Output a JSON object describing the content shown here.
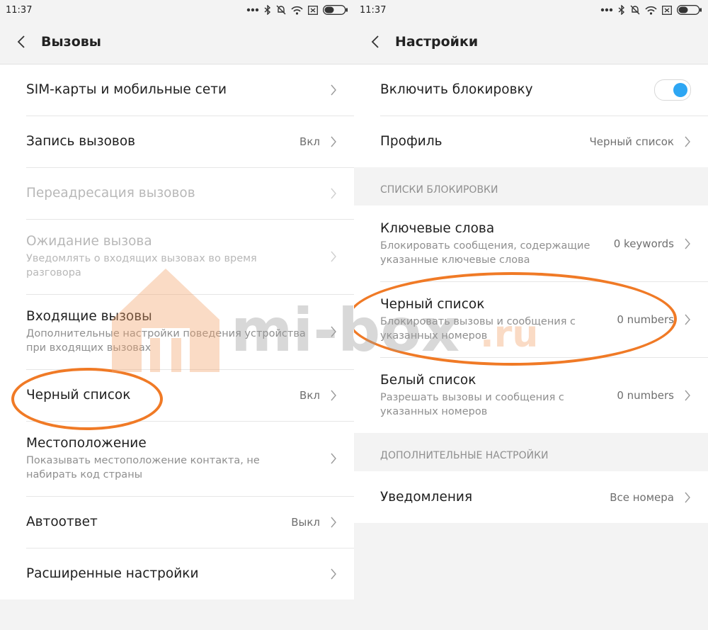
{
  "left": {
    "status": {
      "time": "11:37"
    },
    "header": {
      "title": "Вызовы"
    },
    "items": [
      {
        "title": "SIM-карты и мобильные сети",
        "value": "",
        "subtitle": ""
      },
      {
        "title": "Запись вызовов",
        "value": "Вкл",
        "subtitle": ""
      },
      {
        "title": "Переадресация вызовов",
        "value": "",
        "subtitle": ""
      },
      {
        "title": "Ожидание вызова",
        "value": "",
        "subtitle": "Уведомлять о входящих вызовах во время разговора"
      },
      {
        "title": "Входящие вызовы",
        "value": "",
        "subtitle": "Дополнительные настройки поведения устройства при входящих вызовах"
      },
      {
        "title": "Черный список",
        "value": "Вкл",
        "subtitle": ""
      },
      {
        "title": "Местоположение",
        "value": "",
        "subtitle": "Показывать местоположение контакта, не набирать код страны"
      },
      {
        "title": "Автоответ",
        "value": "Выкл",
        "subtitle": ""
      },
      {
        "title": "Расширенные настройки",
        "value": "",
        "subtitle": ""
      }
    ]
  },
  "right": {
    "status": {
      "time": "11:37"
    },
    "header": {
      "title": "Настройки"
    },
    "top_items": [
      {
        "title": "Включить блокировку",
        "toggle_on": true
      },
      {
        "title": "Профиль",
        "value": "Черный список"
      }
    ],
    "section1": {
      "header": "СПИСКИ БЛОКИРОВКИ",
      "items": [
        {
          "title": "Ключевые слова",
          "subtitle": "Блокировать сообщения, содержащие указанные ключевые слова",
          "value": "0 keywords"
        },
        {
          "title": "Черный список",
          "subtitle": "Блокировать вызовы и сообщения с указанных номеров",
          "value": "0 numbers"
        },
        {
          "title": "Белый список",
          "subtitle": "Разрешать вызовы и сообщения с указанных номеров",
          "value": "0 numbers"
        }
      ]
    },
    "section2": {
      "header": "ДОПОЛНИТЕЛЬНЫЕ НАСТРОЙКИ",
      "items": [
        {
          "title": "Уведомления",
          "value": "Все номера"
        }
      ]
    }
  },
  "watermark": {
    "text_main": "mi-box",
    "text_domain": ".ru"
  },
  "colors": {
    "accent": "#2da6f3",
    "highlight": "#f07a26",
    "watermark": "#f4a36a"
  },
  "icons": [
    "back-arrow-icon",
    "chevron-right-icon",
    "bluetooth-icon",
    "bell-muted-icon",
    "wifi-icon",
    "sim-none-icon",
    "battery-icon",
    "notification-dots-icon"
  ]
}
